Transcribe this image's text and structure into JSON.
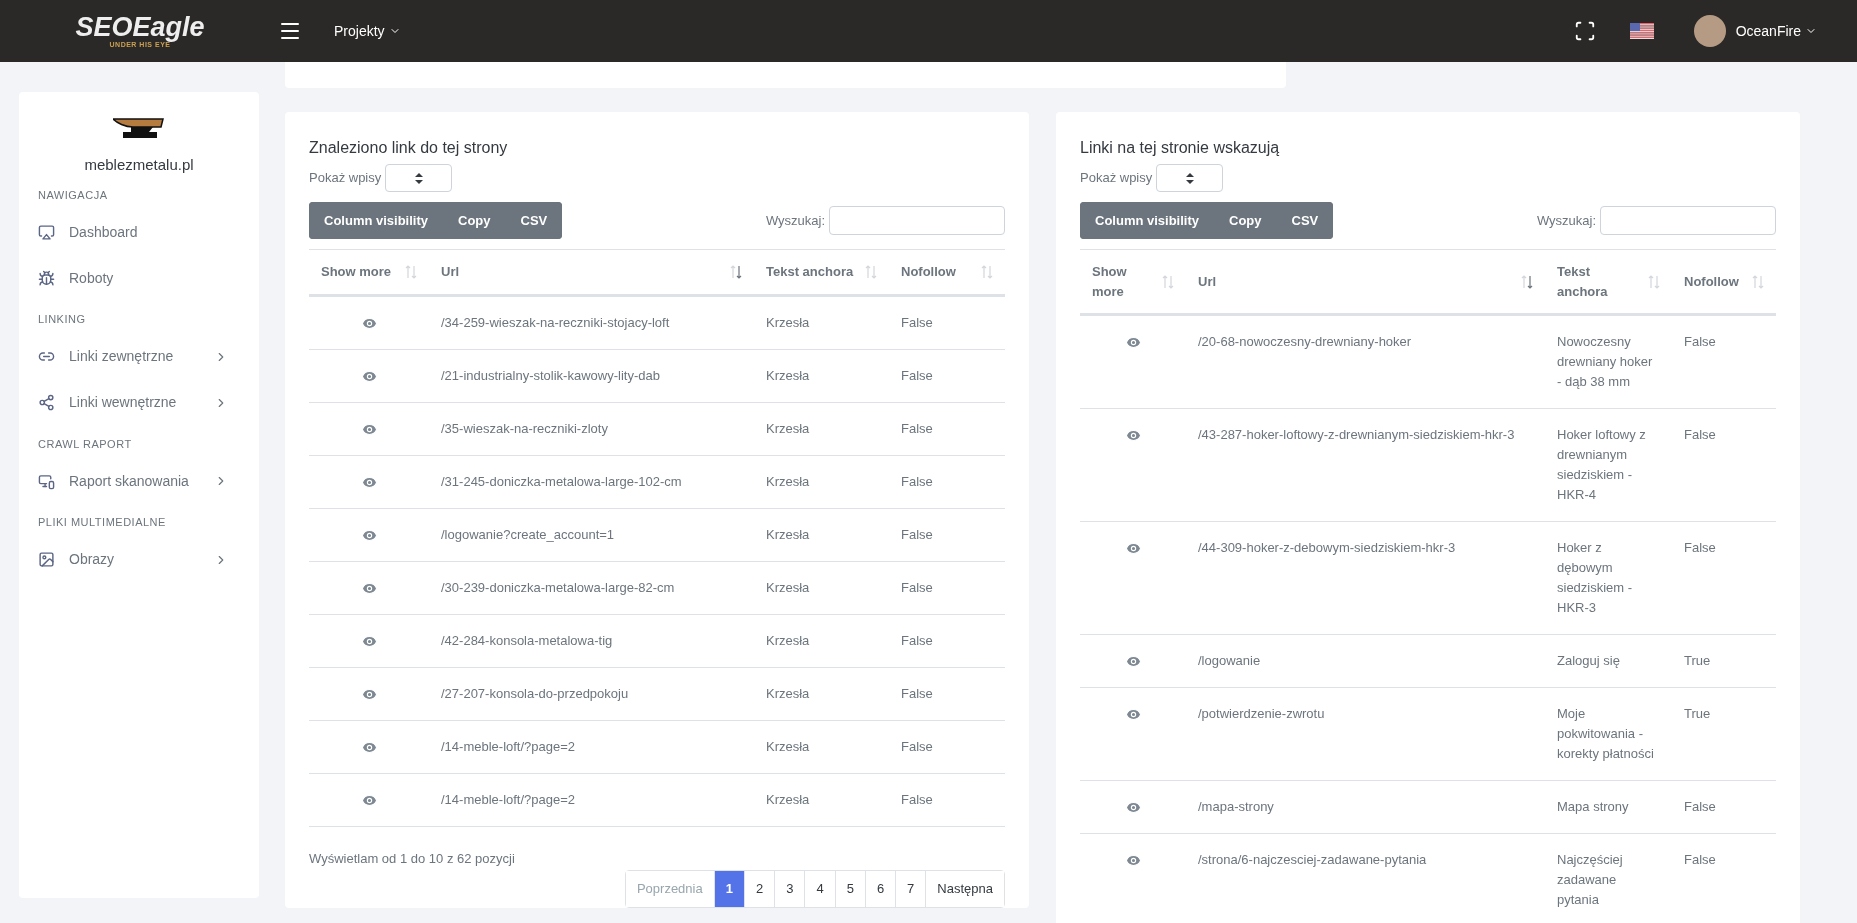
{
  "header": {
    "logo": {
      "name": "SEOEagle",
      "tagline": "UNDER HIS EYE"
    },
    "menu": "Projekty",
    "user": "OceanFire"
  },
  "sidebar": {
    "site": "meblezmetalu.pl",
    "sections": [
      {
        "title": "NAWIGACJA",
        "items": [
          {
            "label": "Dashboard",
            "expandable": false
          },
          {
            "label": "Roboty",
            "expandable": false
          }
        ]
      },
      {
        "title": "LINKING",
        "items": [
          {
            "label": "Linki zewnętrzne",
            "expandable": true
          },
          {
            "label": "Linki wewnętrzne",
            "expandable": true
          }
        ]
      },
      {
        "title": "CRAWL RAPORT",
        "items": [
          {
            "label": "Raport skanowania",
            "expandable": true
          }
        ]
      },
      {
        "title": "PLIKI MULTIMEDIALNE",
        "items": [
          {
            "label": "Obrazy",
            "expandable": true
          }
        ]
      }
    ]
  },
  "tables": [
    {
      "title": "Znaleziono link do tej strony",
      "length_label": "Pokaż wpisy",
      "buttons": [
        "Column visibility",
        "Copy",
        "CSV"
      ],
      "search_label": "Wyszukaj:",
      "columns": [
        {
          "label": "Show more",
          "sorted": false
        },
        {
          "label": "Url",
          "sorted": true
        },
        {
          "label": "Tekst anchora",
          "sorted": false
        },
        {
          "label": "Nofollow",
          "sorted": false
        }
      ],
      "rows": [
        [
          "",
          "/34-259-wieszak-na-reczniki-stojacy-loft",
          "Krzesła",
          "False"
        ],
        [
          "",
          "/21-industrialny-stolik-kawowy-lity-dab",
          "Krzesła",
          "False"
        ],
        [
          "",
          "/35-wieszak-na-reczniki-zloty",
          "Krzesła",
          "False"
        ],
        [
          "",
          "/31-245-doniczka-metalowa-large-102-cm",
          "Krzesła",
          "False"
        ],
        [
          "",
          "/logowanie?create_account=1",
          "Krzesła",
          "False"
        ],
        [
          "",
          "/30-239-doniczka-metalowa-large-82-cm",
          "Krzesła",
          "False"
        ],
        [
          "",
          "/42-284-konsola-metalowa-tig",
          "Krzesła",
          "False"
        ],
        [
          "",
          "/27-207-konsola-do-przedpokoju",
          "Krzesła",
          "False"
        ],
        [
          "",
          "/14-meble-loft/?page=2",
          "Krzesła",
          "False"
        ],
        [
          "",
          "/14-meble-loft/?page=2",
          "Krzesła",
          "False"
        ]
      ],
      "info": "Wyświetlam od 1 do 10 z 62 pozycji",
      "pagination": [
        {
          "label": "Poprzednia",
          "selected": false,
          "disabled": true
        },
        {
          "label": "1",
          "selected": true,
          "disabled": false
        },
        {
          "label": "2",
          "selected": false,
          "disabled": false
        },
        {
          "label": "3",
          "selected": false,
          "disabled": false
        },
        {
          "label": "4",
          "selected": false,
          "disabled": false
        },
        {
          "label": "5",
          "selected": false,
          "disabled": false
        },
        {
          "label": "6",
          "selected": false,
          "disabled": false
        },
        {
          "label": "7",
          "selected": false,
          "disabled": false
        },
        {
          "label": "Następna",
          "selected": false,
          "disabled": false
        }
      ]
    },
    {
      "title": "Linki na tej stronie wskazują",
      "length_label": "Pokaż wpisy",
      "buttons": [
        "Column visibility",
        "Copy",
        "CSV"
      ],
      "search_label": "Wyszukaj:",
      "columns": [
        {
          "label": "Show more",
          "sorted": false
        },
        {
          "label": "Url",
          "sorted": true
        },
        {
          "label": "Tekst anchora",
          "sorted": false
        },
        {
          "label": "Nofollow",
          "sorted": false
        }
      ],
      "rows": [
        [
          "",
          "/20-68-nowoczesny-drewniany-hoker",
          "Nowoczesny drewniany hoker - dąb 38 mm",
          "False"
        ],
        [
          "",
          "/43-287-hoker-loftowy-z-drewnianym-siedziskiem-hkr-3",
          "Hoker loftowy z drewnianym siedziskiem - HKR-4",
          "False"
        ],
        [
          "",
          "/44-309-hoker-z-debowym-siedziskiem-hkr-3",
          "Hoker z dębowym siedziskiem - HKR-3",
          "False"
        ],
        [
          "",
          "/logowanie",
          "Zaloguj się",
          "True"
        ],
        [
          "",
          "/potwierdzenie-zwrotu",
          "Moje pokwitowania - korekty płatności",
          "True"
        ],
        [
          "",
          "/mapa-strony",
          "Mapa strony",
          "False"
        ],
        [
          "",
          "/strona/6-najczesciej-zadawane-pytania",
          "Najczęściej zadawane pytania",
          "False"
        ]
      ]
    }
  ]
}
